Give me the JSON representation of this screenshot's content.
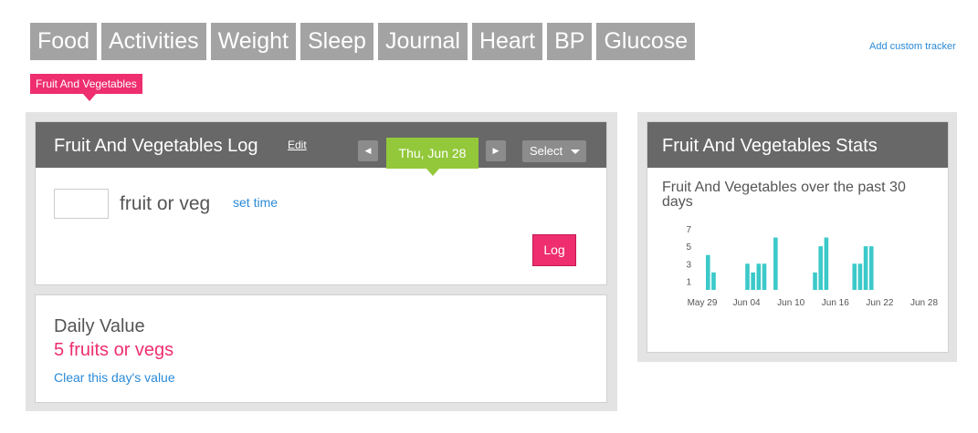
{
  "tabs": [
    "Food",
    "Activities",
    "Weight",
    "Sleep",
    "Journal",
    "Heart",
    "BP",
    "Glucose"
  ],
  "add_custom_tracker": "Add custom tracker",
  "subtab": "Fruit And Vegetables",
  "log_panel": {
    "title": "Fruit And Vegetables Log",
    "edit": "Edit",
    "prev_icon": "◀",
    "next_icon": "▶",
    "date": "Thu, Jun 28",
    "select": "Select",
    "input_value": "",
    "unit": "fruit or veg",
    "set_time": "set time",
    "log_button": "Log"
  },
  "daily_panel": {
    "title": "Daily Value",
    "value": "5 fruits or vegs",
    "clear": "Clear this day's value"
  },
  "stats_panel": {
    "title": "Fruit And Vegetables Stats",
    "chart_title": "Fruit And Vegetables over the past 30 days"
  },
  "colors": {
    "accent": "#ee2e6e",
    "date_green": "#93c83b",
    "bar": "#3cc9c9",
    "header": "#686868",
    "link": "#2a8ad8"
  },
  "chart_data": {
    "type": "bar",
    "title": "Fruit And Vegetables over the past 30 days",
    "yticks": [
      1,
      3,
      5,
      7
    ],
    "ylim": [
      0,
      7
    ],
    "xtick_labels": [
      "May 29",
      "Jun 04",
      "Jun 10",
      "Jun 16",
      "Jun 22",
      "Jun 28"
    ],
    "categories": [
      "May 30",
      "May 31",
      "Jun 01",
      "Jun 02",
      "Jun 03",
      "Jun 04",
      "Jun 05",
      "Jun 06",
      "Jun 07",
      "Jun 08",
      "Jun 09",
      "Jun 10",
      "Jun 11",
      "Jun 12",
      "Jun 13",
      "Jun 14",
      "Jun 15",
      "Jun 16",
      "Jun 17",
      "Jun 18",
      "Jun 19",
      "Jun 20",
      "Jun 21",
      "Jun 22",
      "Jun 23",
      "Jun 24",
      "Jun 25",
      "Jun 26",
      "Jun 27",
      "Jun 28"
    ],
    "values": [
      4,
      2,
      0,
      0,
      0,
      0,
      0,
      3,
      2,
      3,
      3,
      0,
      6,
      0,
      0,
      0,
      0,
      0,
      0,
      2,
      5,
      6,
      0,
      0,
      0,
      0,
      3,
      3,
      5,
      5
    ]
  }
}
